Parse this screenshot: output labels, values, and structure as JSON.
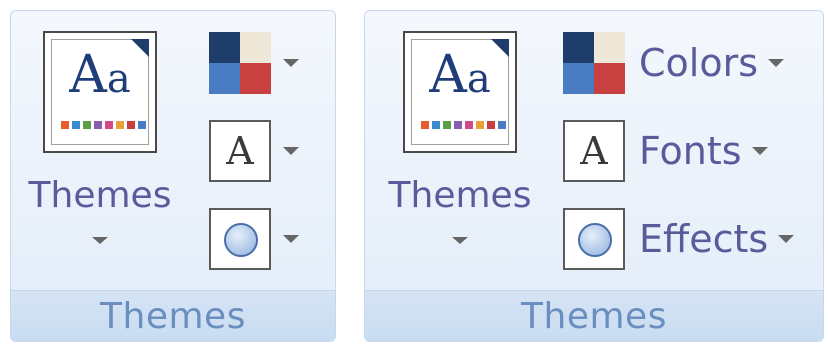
{
  "group_title": "Themes",
  "themes_button": {
    "label": "Themes",
    "preview_text": "Aa",
    "swatch_colors": [
      "#e65d2e",
      "#3a8bd0",
      "#5aa046",
      "#8a5cb0",
      "#d34a8a",
      "#e8a23a",
      "#c94040",
      "#4a7cc4"
    ]
  },
  "colors_button": {
    "label": "Colors",
    "quadrants": [
      "#1f3d6b",
      "#efe8d8",
      "#4a7cc4",
      "#c94040"
    ]
  },
  "fonts_button": {
    "label": "Fonts",
    "icon_text": "A"
  },
  "effects_button": {
    "label": "Effects",
    "icon": "circle-effect-icon"
  }
}
